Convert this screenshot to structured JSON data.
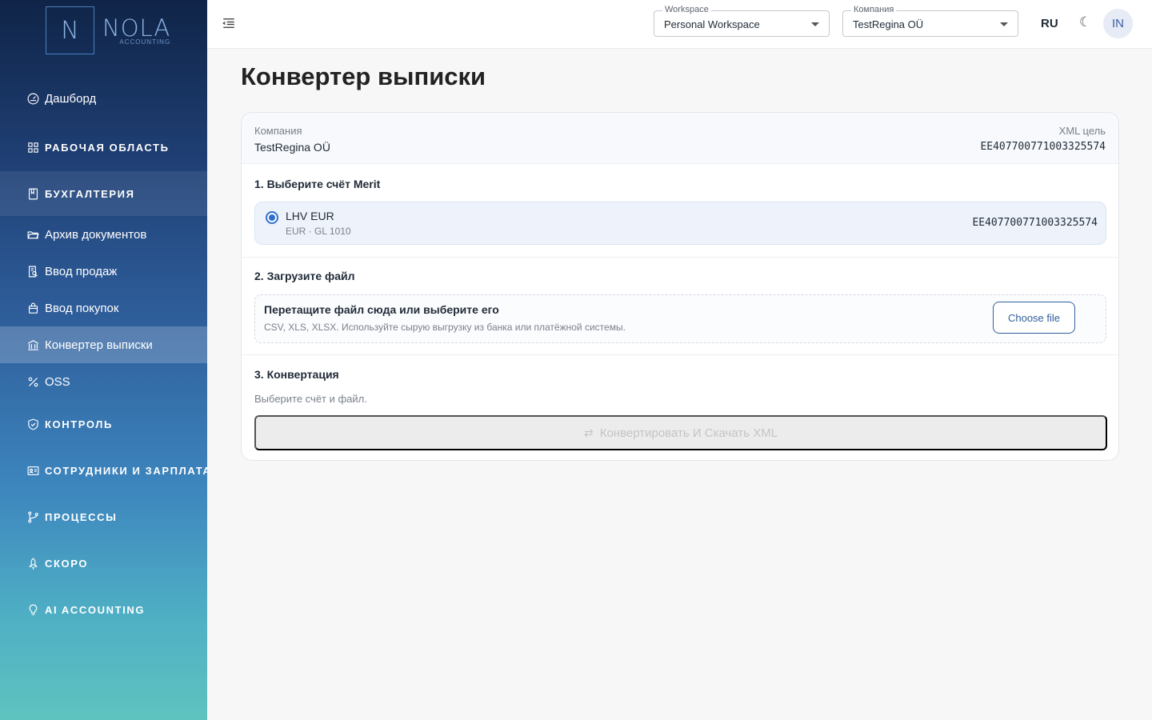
{
  "brand": {
    "letter": "N",
    "name": "NOLA",
    "subtitle": "ACCOUNTING"
  },
  "sidebar": {
    "items": [
      {
        "label": "Дашборд",
        "icon": "dashboard-gauge-icon"
      },
      {
        "label": "РАБОЧАЯ ОБЛАСТЬ",
        "icon": "grid-icon"
      },
      {
        "label": "БУХГАЛТЕРИЯ",
        "icon": "book-icon"
      },
      {
        "label": "Архив документов",
        "icon": "folder-open-icon"
      },
      {
        "label": "Ввод продаж",
        "icon": "receipt-search-icon"
      },
      {
        "label": "Ввод покупок",
        "icon": "shopping-bag-icon"
      },
      {
        "label": "Конвертер выписки",
        "icon": "bank-icon"
      },
      {
        "label": "OSS",
        "icon": "percent-icon"
      },
      {
        "label": "КОНТРОЛЬ",
        "icon": "shield-check-icon"
      },
      {
        "label": "СОТРУДНИКИ И ЗАРПЛАТА",
        "icon": "id-card-icon"
      },
      {
        "label": "ПРОЦЕССЫ",
        "icon": "git-branch-icon"
      },
      {
        "label": "СКОРО",
        "icon": "rocket-icon"
      },
      {
        "label": "AI ACCOUNTING",
        "icon": "lightbulb-icon"
      }
    ]
  },
  "header": {
    "workspace": {
      "label": "Workspace",
      "value": "Personal Workspace"
    },
    "company": {
      "label": "Компания",
      "value": "TestRegina OÜ"
    },
    "language": "RU",
    "theme_icon": "☾",
    "avatar": "IN"
  },
  "page": {
    "title": "Конвертер выписки",
    "company_label": "Компания",
    "company_value": "TestRegina OÜ",
    "xml_label": "XML цель",
    "xml_value": "EE407700771003325574",
    "step1_title": "1. Выберите счёт Merit",
    "account": {
      "name": "LHV EUR",
      "sub": "EUR · GL 1010",
      "iban": "EE407700771003325574"
    },
    "step2_title": "2. Загрузите файл",
    "dropzone_title": "Перетащите файл сюда или выберите его",
    "dropzone_sub": "CSV, XLS, XLSX. Используйте сырую выгрузку из банка или платёжной системы.",
    "choose_file": "Choose file",
    "step3_title": "3. Конвертация",
    "hint": "Выберите счёт и файл.",
    "convert_label": "Конвертировать И Скачать XML",
    "convert_icon": "⇄"
  },
  "colors": {
    "accent": "#2f6fd1",
    "brand_dark": "#0f2447",
    "brand_teal": "#5ec3bf",
    "button_outline": "#2f5f9c"
  }
}
